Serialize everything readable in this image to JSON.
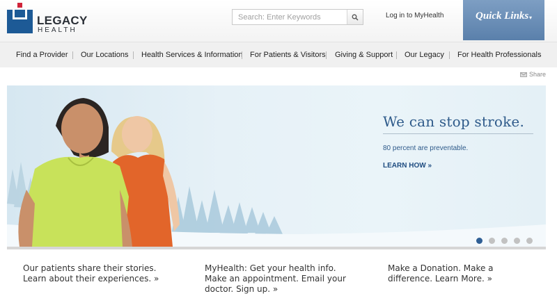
{
  "logo": {
    "line1": "LEGACY",
    "line2": "HEALTH",
    "mark_color": "#1d5a96",
    "accent_color": "#d0243a"
  },
  "search": {
    "placeholder": "Search: Enter Keywords",
    "icon": "magnifier-icon"
  },
  "header": {
    "login_link": "Log in to MyHealth",
    "quick_links_label": "Quick Links",
    "quick_links_caret": "▾"
  },
  "nav": {
    "items": [
      "Find a Provider",
      "Our Locations",
      "Health Services & Information",
      "For Patients & Visitors",
      "Giving & Support",
      "Our Legacy",
      "For Health Professionals"
    ]
  },
  "share": {
    "label": "Share",
    "icon": "envelope-icon"
  },
  "hero": {
    "title": "We can stop stroke.",
    "subtitle": "80 percent are preventable.",
    "cta": "LEARN HOW »",
    "slide_count": 5,
    "active_slide": 1
  },
  "blurbs": [
    {
      "line1": "Our patients share their stories.",
      "line2": "Learn about their experiences. »",
      "line3": ""
    },
    {
      "line1": "MyHealth: Get your health info.",
      "line2": "Make an appointment. Email your",
      "line3": "doctor. Sign up. »"
    },
    {
      "line1": "Make a Donation. Make a",
      "line2": "difference. Learn More. »",
      "line3": ""
    }
  ],
  "colors": {
    "brand_blue": "#2e5a8a",
    "quick_links_bg": "#6b8fb8",
    "active_dot": "#2f5f95"
  }
}
